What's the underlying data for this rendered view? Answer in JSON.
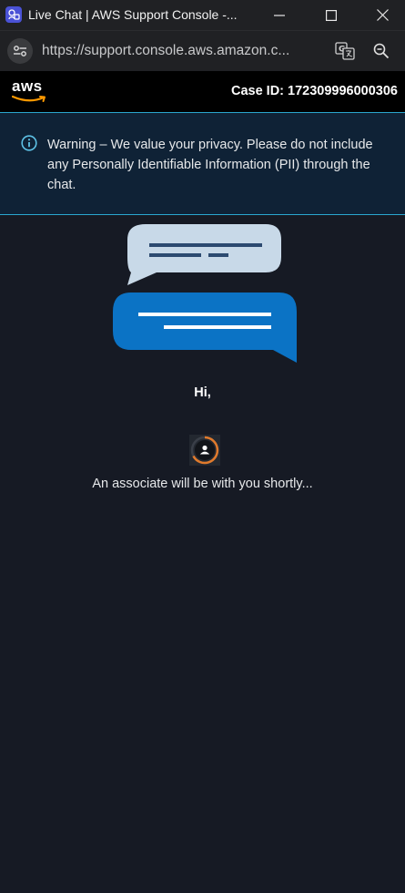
{
  "window": {
    "title": "Live Chat | AWS Support Console -...",
    "icons": {
      "app": "chat-app-icon",
      "minimize": "minimize-icon",
      "maximize": "maximize-icon",
      "close": "close-icon"
    }
  },
  "address_bar": {
    "url": "https://support.console.aws.amazon.c...",
    "icons": {
      "site_info": "site-settings-icon",
      "translate": "translate-icon",
      "zoom": "zoom-icon"
    }
  },
  "header": {
    "logo_text": "aws",
    "case_id": "Case ID: 172309996000306"
  },
  "warning": {
    "icon": "info-icon",
    "text": "Warning – We value your privacy. Please do not include any Personally Identifiable Information (PII) through the chat."
  },
  "main": {
    "illustration": "chat-bubbles-icon",
    "greeting": "Hi,",
    "avatar": "agent-avatar-icon",
    "status": "An associate will be with you shortly..."
  },
  "colors": {
    "background": "#161a24",
    "chrome": "#202124",
    "header": "#000000",
    "warning_bg": "#0f2236",
    "warning_border": "#2aa7cf",
    "bubble_light": "#c8d9e8",
    "bubble_blue": "#0b73c5",
    "avatar_ring": "#e07a2c"
  }
}
